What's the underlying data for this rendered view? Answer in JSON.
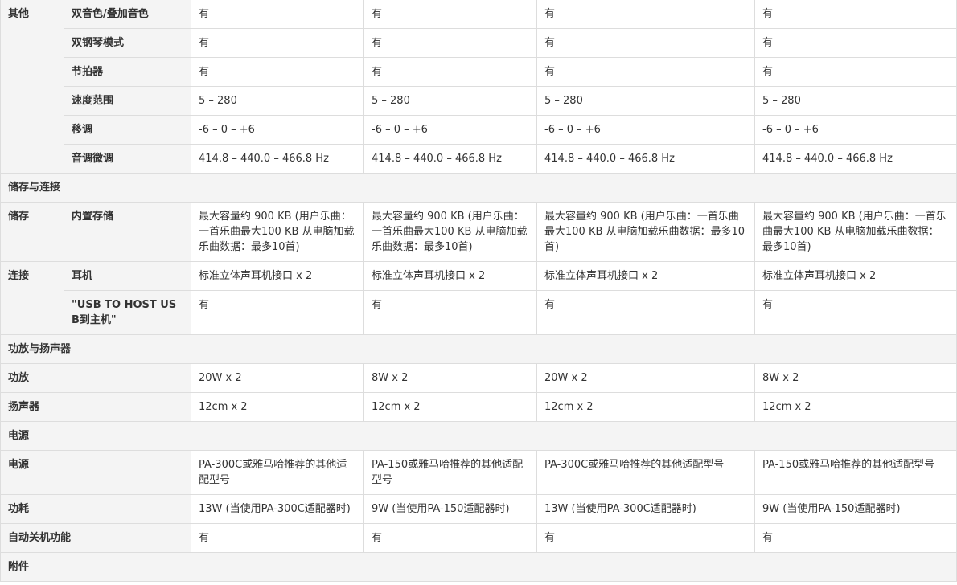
{
  "other": {
    "category": "其他",
    "rows": [
      {
        "label": "双音色/叠加音色",
        "values": [
          "有",
          "有",
          "有",
          "有"
        ]
      },
      {
        "label": "双钢琴模式",
        "values": [
          "有",
          "有",
          "有",
          "有"
        ]
      },
      {
        "label": "节拍器",
        "values": [
          "有",
          "有",
          "有",
          "有"
        ]
      },
      {
        "label": "速度范围",
        "values": [
          "5 – 280",
          "5 – 280",
          "5 – 280",
          "5 – 280"
        ]
      },
      {
        "label": "移调",
        "values": [
          "-6 – 0 – +6",
          "-6 – 0 – +6",
          "-6 – 0 – +6",
          "-6 – 0 – +6"
        ]
      },
      {
        "label": "音调微调",
        "values": [
          "414.8 – 440.0 – 466.8 Hz",
          "414.8 – 440.0 – 466.8 Hz",
          "414.8 – 440.0 – 466.8 Hz",
          "414.8 – 440.0 – 466.8 Hz"
        ]
      }
    ]
  },
  "storage_section": {
    "title": "储存与连接",
    "storage": {
      "category": "储存",
      "label": "内置存储",
      "values": [
        "最大容量约 900 KB (用户乐曲：一首乐曲最大100 KB 从电脑加载乐曲数据：最多10首)",
        "最大容量约 900 KB (用户乐曲：一首乐曲最大100 KB 从电脑加载乐曲数据：最多10首)",
        "最大容量约 900 KB (用户乐曲：一首乐曲最大100 KB 从电脑加载乐曲数据：最多10首)",
        "最大容量约 900 KB (用户乐曲：一首乐曲最大100 KB 从电脑加载乐曲数据：最多10首)"
      ]
    },
    "connect": {
      "category": "连接",
      "rows": [
        {
          "label": "耳机",
          "values": [
            "标准立体声耳机接口 x 2",
            "标准立体声耳机接口 x 2",
            "标准立体声耳机接口 x 2",
            "标准立体声耳机接口 x 2"
          ]
        },
        {
          "label": "\"USB TO HOST USB到主机\"",
          "values": [
            "有",
            "有",
            "有",
            "有"
          ]
        }
      ]
    }
  },
  "amp_section": {
    "title": "功放与扬声器",
    "rows": [
      {
        "label": "功放",
        "values": [
          "20W x 2",
          "8W x 2",
          "20W x 2",
          "8W x 2"
        ]
      },
      {
        "label": "扬声器",
        "values": [
          "12cm x 2",
          "12cm x 2",
          "12cm x 2",
          "12cm x 2"
        ]
      }
    ]
  },
  "power_section": {
    "title": "电源",
    "rows": [
      {
        "label": "电源",
        "values": [
          "PA-300C或雅马哈推荐的其他适配型号",
          "PA-150或雅马哈推荐的其他适配型号",
          "PA-300C或雅马哈推荐的其他适配型号",
          "PA-150或雅马哈推荐的其他适配型号"
        ]
      },
      {
        "label": "功耗",
        "values": [
          "13W (当使用PA-300C适配器时)",
          "9W (当使用PA-150适配器时)",
          "13W (当使用PA-300C适配器时)",
          "9W (当使用PA-150适配器时)"
        ]
      },
      {
        "label": "自动关机功能",
        "values": [
          "有",
          "有",
          "有",
          "有"
        ]
      }
    ]
  },
  "accessories_section": {
    "title": "附件"
  }
}
